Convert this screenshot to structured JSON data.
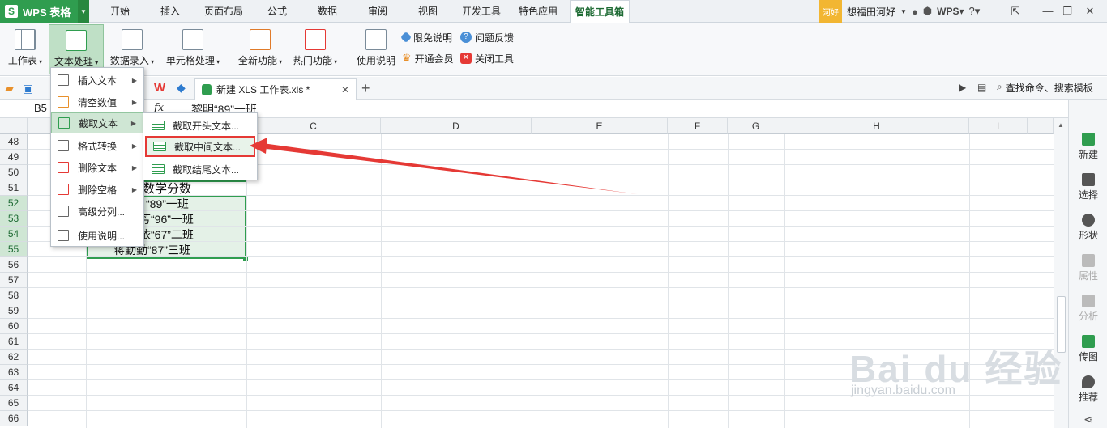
{
  "app": {
    "title": "WPS 表格"
  },
  "menu_tabs": [
    "开始",
    "插入",
    "页面布局",
    "公式",
    "数据",
    "审阅",
    "视图",
    "开发工具",
    "特色应用",
    "智能工具箱"
  ],
  "user": {
    "avatar_text": "河好",
    "name": "想福田河好"
  },
  "ribbon": {
    "buttons": [
      "工作表",
      "文本处理",
      "数据录入",
      "单元格处理",
      "全新功能",
      "热门功能",
      "使用说明"
    ],
    "small": [
      "限免说明",
      "问题反馈",
      "开通会员",
      "关闭工具"
    ]
  },
  "doc": {
    "tab_title": "新建 XLS 工作表.xls *",
    "search": "查找命令、搜索模板"
  },
  "formula": {
    "cell_ref": "B5",
    "fx": "fx",
    "value": "黎明“89”一班"
  },
  "columns": [
    "C",
    "D",
    "E",
    "F",
    "G",
    "H",
    "I"
  ],
  "rows": [
    "48",
    "49",
    "50",
    "51",
    "52",
    "53",
    "54",
    "55",
    "56",
    "57",
    "58",
    "59",
    "60",
    "61",
    "62",
    "63",
    "64",
    "65",
    "66"
  ],
  "cells": {
    "header": "数学分数",
    "r52": "“89”一班",
    "r53": "芳“96”一班",
    "r54": "依“67”二班",
    "r55": "蒋勤勤“87”三班"
  },
  "menu": {
    "items": [
      "插入文本",
      "清空数值",
      "截取文本",
      "格式转换",
      "删除文本",
      "删除空格",
      "高级分列...",
      "使用说明..."
    ]
  },
  "submenu": {
    "items": [
      "截取开头文本...",
      "截取中间文本...",
      "截取结尾文本..."
    ]
  },
  "rightpane": [
    "新建",
    "选择",
    "形状",
    "属性",
    "分析",
    "传图",
    "推荐"
  ],
  "watermark": {
    "logo": "Bai du 经验",
    "url": "jingyan.baidu.com"
  }
}
